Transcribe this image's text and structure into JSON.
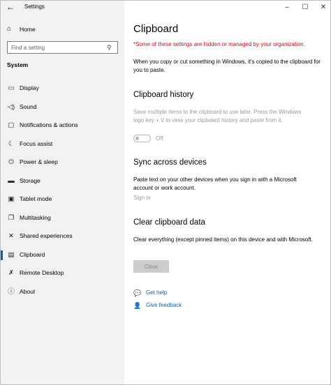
{
  "window": {
    "title": "Settings",
    "back_icon": "back-arrow-icon",
    "controls": {
      "minimize": "–",
      "maximize": "☐",
      "close": "✕"
    }
  },
  "sidebar": {
    "home_label": "Home",
    "search_placeholder": "Find a setting",
    "section_label": "System",
    "items": [
      {
        "label": "Display",
        "icon": "monitor-icon",
        "glyph": "▭"
      },
      {
        "label": "Sound",
        "icon": "speaker-icon",
        "glyph": "🔈"
      },
      {
        "label": "Notifications & actions",
        "icon": "notification-icon",
        "glyph": "▢"
      },
      {
        "label": "Focus assist",
        "icon": "moon-icon",
        "glyph": "☾"
      },
      {
        "label": "Power & sleep",
        "icon": "power-icon",
        "glyph": "⏻"
      },
      {
        "label": "Storage",
        "icon": "storage-icon",
        "glyph": "▬"
      },
      {
        "label": "Tablet mode",
        "icon": "tablet-icon",
        "glyph": "▣"
      },
      {
        "label": "Multitasking",
        "icon": "multitasking-icon",
        "glyph": "❐"
      },
      {
        "label": "Shared experiences",
        "icon": "shared-experiences-icon",
        "glyph": "✕"
      },
      {
        "label": "Clipboard",
        "icon": "clipboard-icon",
        "glyph": "📋"
      },
      {
        "label": "Remote Desktop",
        "icon": "remote-desktop-icon",
        "glyph": "✗"
      },
      {
        "label": "About",
        "icon": "info-icon",
        "glyph": "ⓘ"
      }
    ],
    "active_item": "Clipboard"
  },
  "main": {
    "title": "Clipboard",
    "warning": "*Some of these settings are hidden or managed by your organization.",
    "description": "When you copy or cut something in Windows, it's copied to the clipboard for you to paste.",
    "history": {
      "heading": "Clipboard history",
      "description": "Save multiple items to the clipboard to use later. Press the Windows logo key + V to view your clipboard history and paste from it.",
      "toggle_state": "Off"
    },
    "sync": {
      "heading": "Sync across devices",
      "description": "Paste text on your other devices when you sign in with a Microsoft account or work account.",
      "signin_label": "Sign in"
    },
    "clear": {
      "heading": "Clear clipboard data",
      "description": "Clear everything (except pinned items) on this device and with Microsoft.",
      "button_label": "Clear"
    },
    "links": {
      "help": "Get help",
      "feedback": "Give feedback"
    }
  },
  "colors": {
    "accent": "#0063b1",
    "warning": "#c50f1f",
    "sidebar_bg": "#f2f2f2",
    "disabled_text": "#9a9a9a"
  }
}
